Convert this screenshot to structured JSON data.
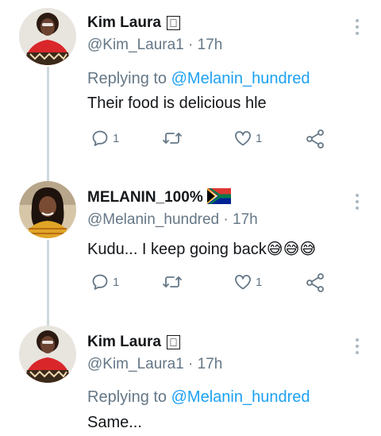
{
  "tweets": [
    {
      "name": "Kim Laura",
      "name_suffix": "\u0000",
      "handle": "@Kim_Laura1",
      "time": "· 17h",
      "reply_prefix": "Replying to",
      "reply_mention": "@Melanin_hundred",
      "text": "Their food is delicious hle",
      "reply_count": "1",
      "retweet_count": "",
      "like_count": "1"
    },
    {
      "name": "MELANIN_100%",
      "handle": "@Melanin_hundred",
      "time": "· 17h",
      "text": "Kudu... I keep going back",
      "emoji": "😅😅😅",
      "reply_count": "1",
      "retweet_count": "",
      "like_count": "1"
    },
    {
      "name": "Kim Laura",
      "name_suffix": "\u0000",
      "handle": "@Kim_Laura1",
      "time": "· 17h",
      "reply_prefix": "Replying to",
      "reply_mention": "@Melanin_hundred",
      "text": "Same..."
    }
  ],
  "colors": {
    "mention": "#1da1f2",
    "secondary_text": "#657786",
    "thread_line": "#cfd9de"
  },
  "icons": [
    "reply-icon",
    "retweet-icon",
    "like-icon",
    "share-icon",
    "more-icon",
    "south-africa-flag-icon"
  ]
}
